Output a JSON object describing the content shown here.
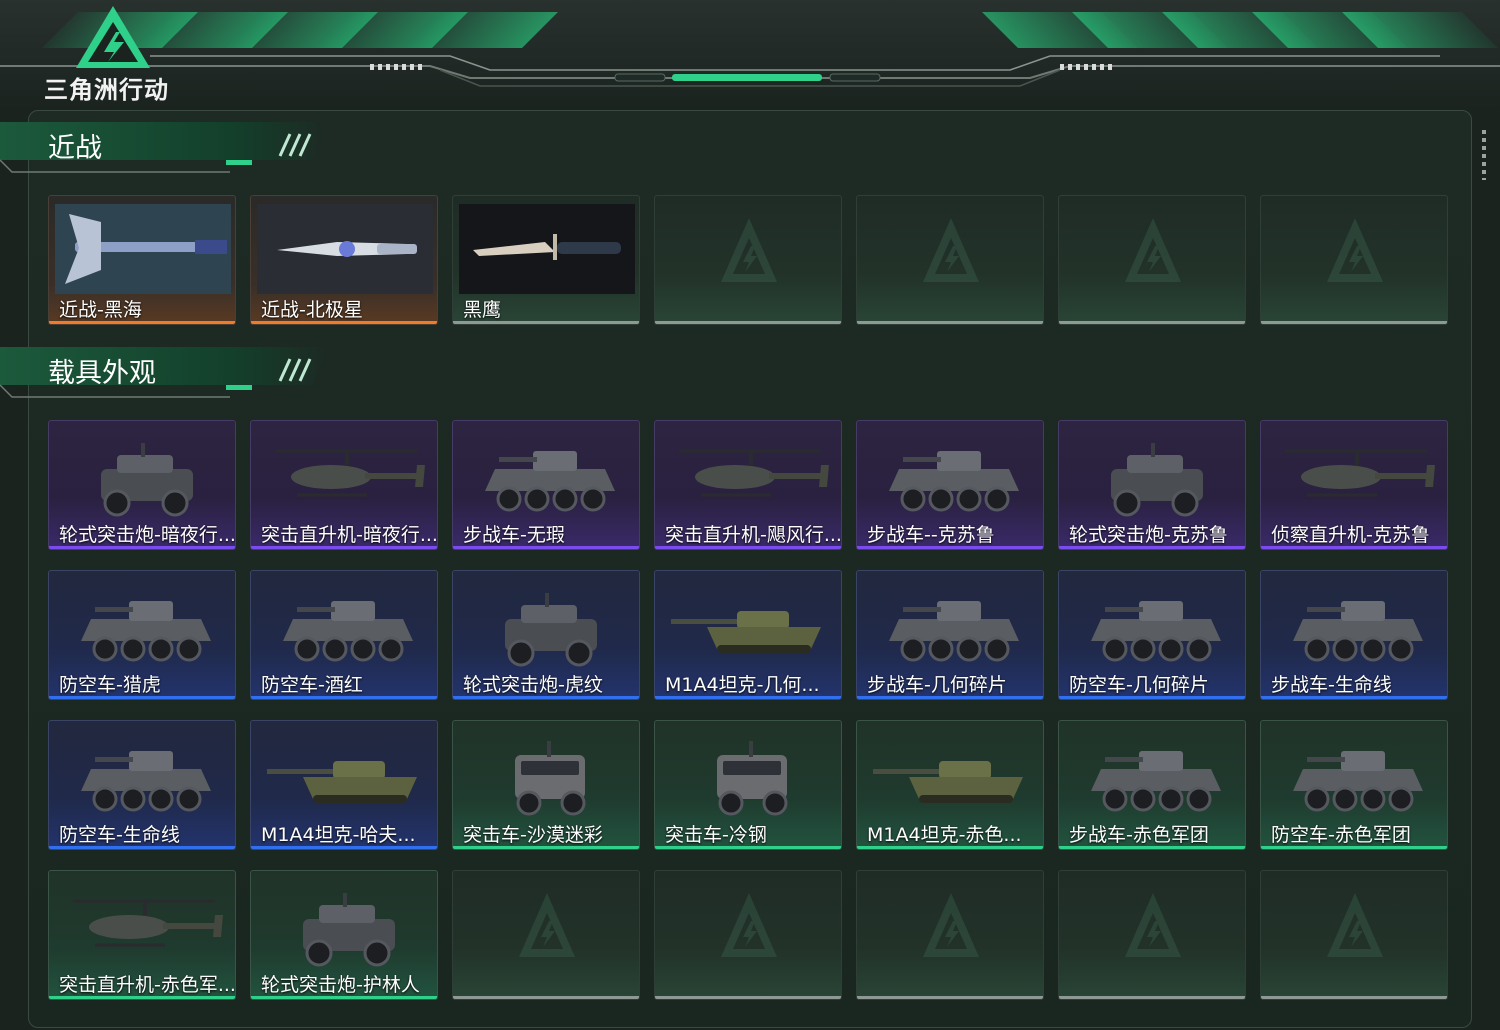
{
  "app": {
    "logo_text": "三角洲行动"
  },
  "sections": [
    {
      "title": "近战",
      "items": [
        {
          "label": "近战-黑海",
          "quality": "orange",
          "icon": "axe-icon"
        },
        {
          "label": "近战-北极星",
          "quality": "orange",
          "icon": "blade-icon"
        },
        {
          "label": "黑鹰",
          "quality": "empty",
          "icon": "knife-icon"
        },
        {
          "label": "",
          "quality": "empty",
          "icon": "empty-slot-icon"
        },
        {
          "label": "",
          "quality": "empty",
          "icon": "empty-slot-icon"
        },
        {
          "label": "",
          "quality": "empty",
          "icon": "empty-slot-icon"
        },
        {
          "label": "",
          "quality": "empty",
          "icon": "empty-slot-icon"
        }
      ]
    },
    {
      "title": "载具外观",
      "items": [
        {
          "label": "轮式突击炮-暗夜行...",
          "quality": "purple",
          "icon": "armored-car-icon"
        },
        {
          "label": "突击直升机-暗夜行...",
          "quality": "purple",
          "icon": "helicopter-icon"
        },
        {
          "label": "步战车-无瑕",
          "quality": "purple",
          "icon": "apc-icon"
        },
        {
          "label": "突击直升机-飓风行...",
          "quality": "purple",
          "icon": "helicopter-icon"
        },
        {
          "label": "步战车--克苏鲁",
          "quality": "purple",
          "icon": "apc-icon"
        },
        {
          "label": "轮式突击炮-克苏鲁",
          "quality": "purple",
          "icon": "armored-car-icon"
        },
        {
          "label": "侦察直升机-克苏鲁",
          "quality": "purple",
          "icon": "helicopter-icon"
        },
        {
          "label": "防空车-猎虎",
          "quality": "blue",
          "icon": "apc-icon"
        },
        {
          "label": "防空车-酒红",
          "quality": "blue",
          "icon": "apc-icon"
        },
        {
          "label": "轮式突击炮-虎纹",
          "quality": "blue",
          "icon": "armored-car-icon"
        },
        {
          "label": "M1A4坦克-几何...",
          "quality": "blue",
          "icon": "tank-icon"
        },
        {
          "label": "步战车-几何碎片",
          "quality": "blue",
          "icon": "apc-icon"
        },
        {
          "label": "防空车-几何碎片",
          "quality": "blue",
          "icon": "apc-icon"
        },
        {
          "label": "步战车-生命线",
          "quality": "blue",
          "icon": "apc-icon"
        },
        {
          "label": "防空车-生命线",
          "quality": "blue",
          "icon": "apc-icon"
        },
        {
          "label": "M1A4坦克-哈夫...",
          "quality": "blue",
          "icon": "tank-icon"
        },
        {
          "label": "突击车-沙漠迷彩",
          "quality": "green",
          "icon": "truck-icon"
        },
        {
          "label": "突击车-冷钢",
          "quality": "green",
          "icon": "truck-icon"
        },
        {
          "label": "M1A4坦克-赤色...",
          "quality": "green",
          "icon": "tank-icon"
        },
        {
          "label": "步战车-赤色军团",
          "quality": "green",
          "icon": "apc-icon"
        },
        {
          "label": "防空车-赤色军团",
          "quality": "green",
          "icon": "apc-icon"
        },
        {
          "label": "突击直升机-赤色军...",
          "quality": "green",
          "icon": "helicopter-icon"
        },
        {
          "label": "轮式突击炮-护林人",
          "quality": "green",
          "icon": "armored-car-icon"
        },
        {
          "label": "",
          "quality": "empty",
          "icon": "empty-slot-icon"
        },
        {
          "label": "",
          "quality": "empty",
          "icon": "empty-slot-icon"
        },
        {
          "label": "",
          "quality": "empty",
          "icon": "empty-slot-icon"
        },
        {
          "label": "",
          "quality": "empty",
          "icon": "empty-slot-icon"
        },
        {
          "label": "",
          "quality": "empty",
          "icon": "empty-slot-icon"
        }
      ]
    }
  ],
  "colors": {
    "accent": "#2ed08a",
    "orange": "#ef7b2c",
    "purple": "#7a4cf0",
    "blue": "#2f6ff0",
    "green": "#2ed08a"
  }
}
